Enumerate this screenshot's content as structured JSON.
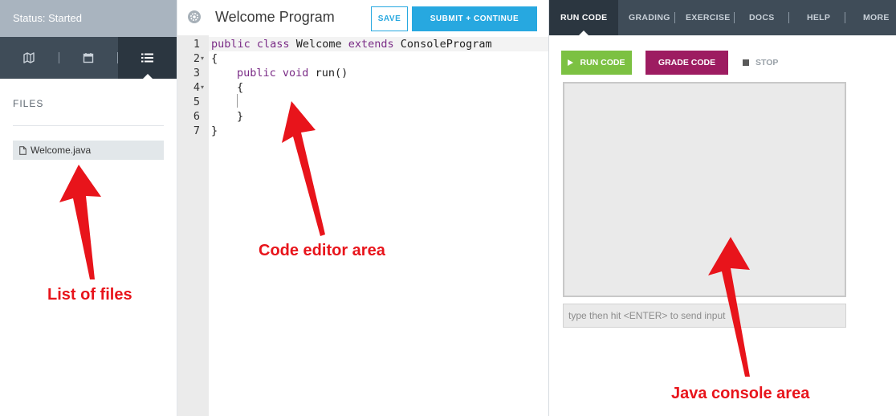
{
  "left": {
    "status": "Status: Started",
    "nav_icons": [
      "map-icon",
      "calendar-icon",
      "list-icon"
    ],
    "files_title": "FILES",
    "files": [
      {
        "name": "Welcome.java"
      }
    ]
  },
  "editor": {
    "title": "Welcome Program",
    "save_label": "SAVE",
    "submit_label": "SUBMIT + CONTINUE",
    "line_numbers": [
      "1",
      "2",
      "3",
      "4",
      "5",
      "6",
      "7"
    ],
    "code": {
      "l1_kw1": "public",
      "l1_kw2": "class",
      "l1_tx1": "Welcome",
      "l1_kw3": "extends",
      "l1_tx2": "ConsoleProgram",
      "l2": "{",
      "l3_kw1": "public",
      "l3_kw2": "void",
      "l3_tx": "run()",
      "l4": "{",
      "l6": "}",
      "l7": "}"
    }
  },
  "right": {
    "tabs": [
      "RUN CODE",
      "GRADING",
      "EXERCISE",
      "DOCS",
      "HELP",
      "MORE"
    ],
    "run_label": "RUN CODE",
    "grade_label": "GRADE CODE",
    "stop_label": "STOP",
    "input_placeholder": "type then hit <ENTER> to send input"
  },
  "annotations": {
    "files": "List of files",
    "editor": "Code editor area",
    "console": "Java console area"
  },
  "colors": {
    "accent_blue": "#27a8e0",
    "run_green": "#7cc142",
    "grade_purple": "#9d1c61",
    "annotation_red": "#e8141b"
  }
}
